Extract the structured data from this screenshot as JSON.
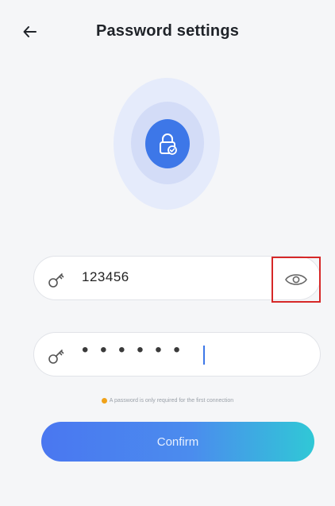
{
  "header": {
    "back_icon": "arrow-left-icon",
    "title": "Password settings"
  },
  "hero": {
    "icon": "lock-check-icon",
    "accent_color": "#3d77e8"
  },
  "fields": [
    {
      "icon": "key-icon",
      "value": "123456",
      "toggle_icon": "eye-icon"
    },
    {
      "icon": "key-icon",
      "value": "• • • • • •"
    }
  ],
  "note": {
    "text": "A password is only required for the first connection"
  },
  "confirm": {
    "label": "Confirm"
  },
  "colors": {
    "background": "#f5f6f8",
    "primary": "#4a77f0",
    "gradient_end": "#30c8d6",
    "highlight_box": "#d62828",
    "note_dot": "#f0a21a"
  }
}
